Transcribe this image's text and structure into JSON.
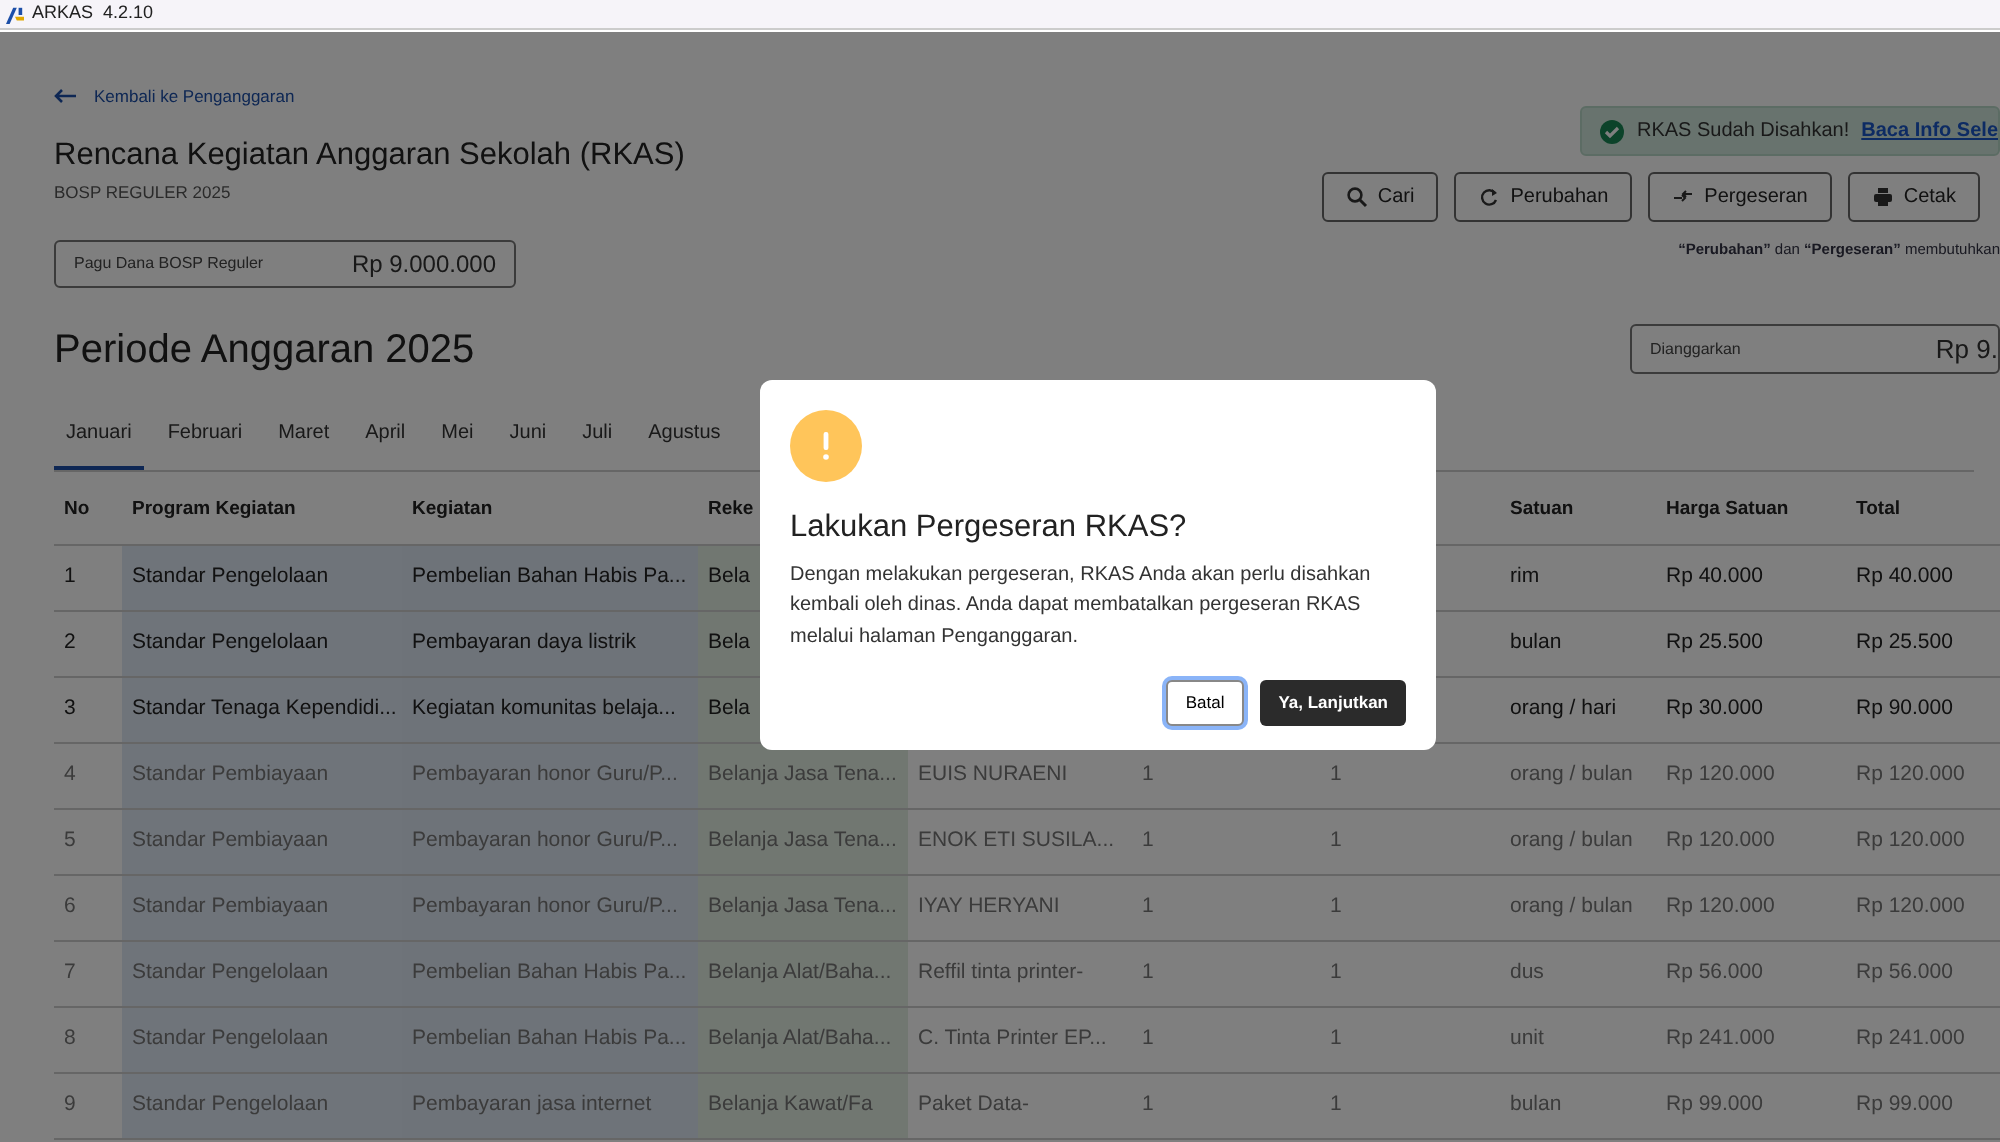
{
  "window": {
    "title": "ARKAS  4.2.10"
  },
  "back_link": "Kembali ke Penganggaran",
  "title": "Rencana Kegiatan Anggaran Sekolah (RKAS)",
  "subtitle": "BOSP REGULER 2025",
  "pagu": {
    "label": "Pagu Dana BOSP Reguler",
    "value": "Rp 9.000.000"
  },
  "alert": {
    "text": "RKAS Sudah Disahkan!",
    "link": "Baca Info Sele"
  },
  "actions": [
    {
      "label": "Cari",
      "kind": "search"
    },
    {
      "label": "Perubahan",
      "kind": "refresh"
    },
    {
      "label": "Pergeseran",
      "kind": "shift"
    },
    {
      "label": "Cetak",
      "kind": "print"
    }
  ],
  "note": "**“Perubahan”** dan **“Pergeseran”** membutuhkan",
  "period_title": "Periode Anggaran 2025",
  "budgeted": {
    "label": "Dianggarkan",
    "value": "Rp 9."
  },
  "tabs": [
    {
      "label": "Januari",
      "selected": true
    },
    {
      "label": "Februari",
      "selected": false
    },
    {
      "label": "Maret",
      "selected": false
    },
    {
      "label": "April",
      "selected": false
    },
    {
      "label": "Mei",
      "selected": false
    },
    {
      "label": "Juni",
      "selected": false
    },
    {
      "label": "Juli",
      "selected": false
    },
    {
      "label": "Agustus",
      "selected": false
    }
  ],
  "table": {
    "columns": [
      "No",
      "Program Kegiatan",
      "Kegiatan",
      "Reke",
      null,
      null,
      null,
      "Satuan",
      "Harga Satuan",
      "Total"
    ],
    "rows": [
      {
        "dimmed": false,
        "cells": [
          "1",
          "Standar Pengelolaan",
          "Pembelian Bahan Habis Pa...",
          "Bela",
          null,
          null,
          null,
          "rim",
          "Rp 40.000",
          "Rp 40.000"
        ]
      },
      {
        "dimmed": false,
        "cells": [
          "2",
          "Standar Pengelolaan",
          "Pembayaran daya listrik",
          "Bela",
          null,
          null,
          null,
          "bulan",
          "Rp 25.500",
          "Rp 25.500"
        ]
      },
      {
        "dimmed": false,
        "cells": [
          "3",
          "Standar Tenaga Kependidi...",
          "Kegiatan komunitas belaja...",
          "Bela",
          null,
          null,
          null,
          "orang / hari",
          "Rp 30.000",
          "Rp 90.000"
        ]
      },
      {
        "dimmed": true,
        "cells": [
          "4",
          "Standar Pembiayaan",
          "Pembayaran honor Guru/P...",
          "Belanja Jasa Tena...",
          "EUIS NURAENI",
          "1",
          "1",
          "orang / bulan",
          "Rp 120.000",
          "Rp 120.000"
        ]
      },
      {
        "dimmed": true,
        "cells": [
          "5",
          "Standar Pembiayaan",
          "Pembayaran honor Guru/P...",
          "Belanja Jasa Tena...",
          "ENOK ETI SUSILA...",
          "1",
          "1",
          "orang / bulan",
          "Rp 120.000",
          "Rp 120.000"
        ]
      },
      {
        "dimmed": true,
        "cells": [
          "6",
          "Standar Pembiayaan",
          "Pembayaran honor Guru/P...",
          "Belanja Jasa Tena...",
          "IYAY HERYANI",
          "1",
          "1",
          "orang / bulan",
          "Rp 120.000",
          "Rp 120.000"
        ]
      },
      {
        "dimmed": true,
        "cells": [
          "7",
          "Standar Pengelolaan",
          "Pembelian Bahan Habis Pa...",
          "Belanja Alat/Baha...",
          "Reffil tinta printer-",
          "1",
          "1",
          "dus",
          "Rp 56.000",
          "Rp 56.000"
        ]
      },
      {
        "dimmed": true,
        "cells": [
          "8",
          "Standar Pengelolaan",
          "Pembelian Bahan Habis Pa...",
          "Belanja Alat/Baha...",
          "C. Tinta Printer EP...",
          "1",
          "1",
          "unit",
          "Rp 241.000",
          "Rp 241.000"
        ]
      },
      {
        "dimmed": true,
        "cells": [
          "9",
          "Standar Pengelolaan",
          "Pembayaran jasa internet",
          "Belanja Kawat/Fa",
          "Paket Data-",
          "1",
          "1",
          "bulan",
          "Rp 99.000",
          "Rp 99.000"
        ]
      }
    ]
  },
  "dialog": {
    "title": "Lakukan Pergeseran RKAS?",
    "message": "Dengan melakukan pergeseran, RKAS Anda akan perlu disahkan kembali oleh dinas. Anda dapat membatalkan pergeseran RKAS melalui halaman Penganggaran.",
    "cancel": "Batal",
    "confirm": "Ya, Lanjutkan"
  }
}
